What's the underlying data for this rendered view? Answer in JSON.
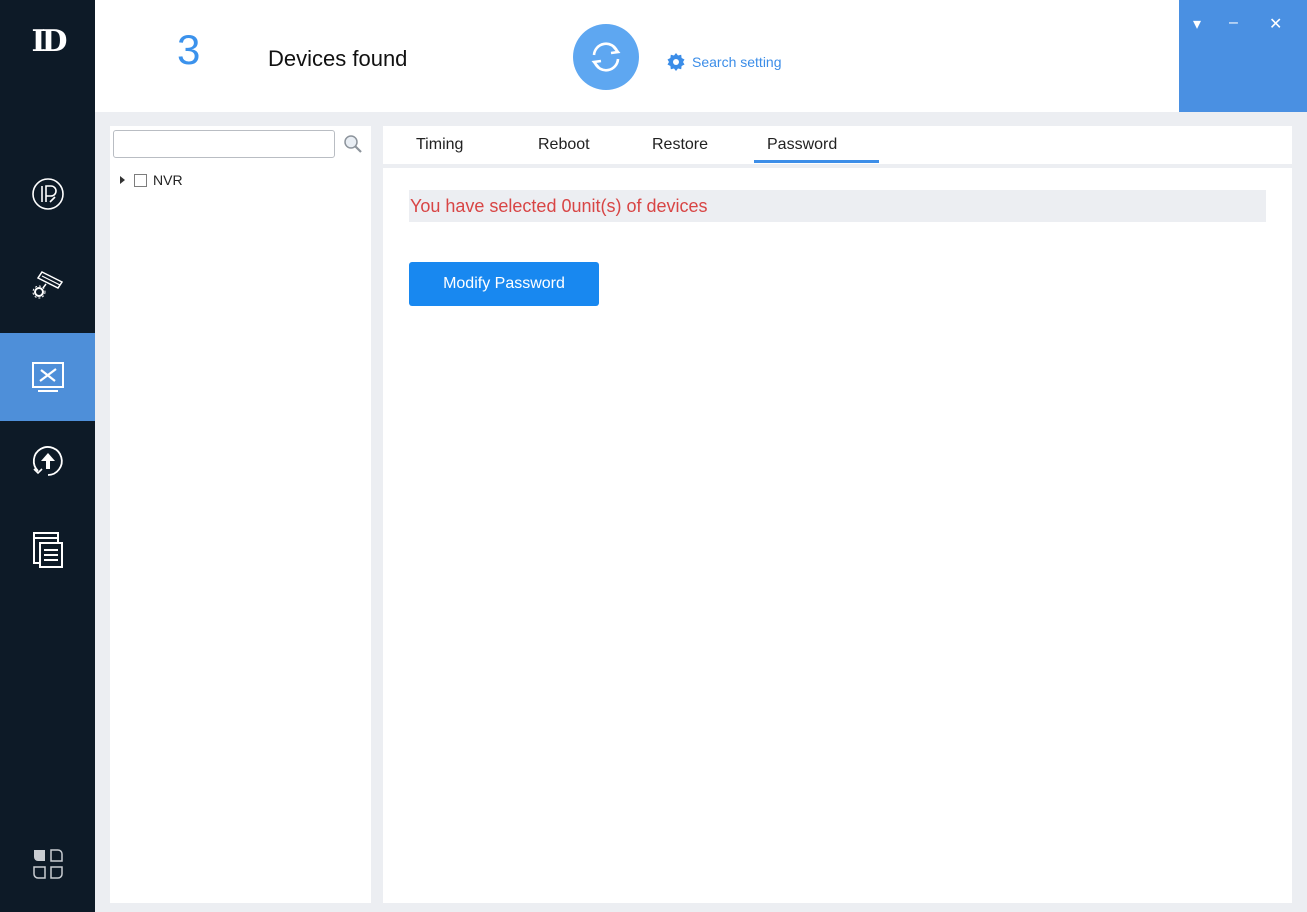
{
  "header": {
    "device_count": "3",
    "devices_label": "Devices found",
    "search_setting_label": "Search setting"
  },
  "window_controls": {
    "menu": "▾",
    "minimize": "–",
    "close": "✕"
  },
  "sidebar": {
    "logo_text": "ID",
    "items": [
      {
        "icon": "ip-icon",
        "active": false
      },
      {
        "icon": "camera-settings-icon",
        "active": false
      },
      {
        "icon": "tools-monitor-icon",
        "active": true
      },
      {
        "icon": "upgrade-icon",
        "active": false
      },
      {
        "icon": "documents-icon",
        "active": false
      },
      {
        "icon": "apps-icon",
        "active": false
      }
    ]
  },
  "device_tree": {
    "search_placeholder": "",
    "nodes": [
      {
        "label": "NVR",
        "checked": false,
        "expanded": false
      }
    ]
  },
  "tabs": {
    "items": [
      "Timing",
      "Reboot",
      "Restore",
      "Password"
    ],
    "active": "Password"
  },
  "password_tab": {
    "notice": "You have selected 0unit(s) of devices",
    "modify_button": "Modify Password"
  },
  "colors": {
    "sidebar_bg": "#0d1a27",
    "accent": "#4e8fd9",
    "button_blue": "#1888f0",
    "notice_red": "#d84545"
  }
}
